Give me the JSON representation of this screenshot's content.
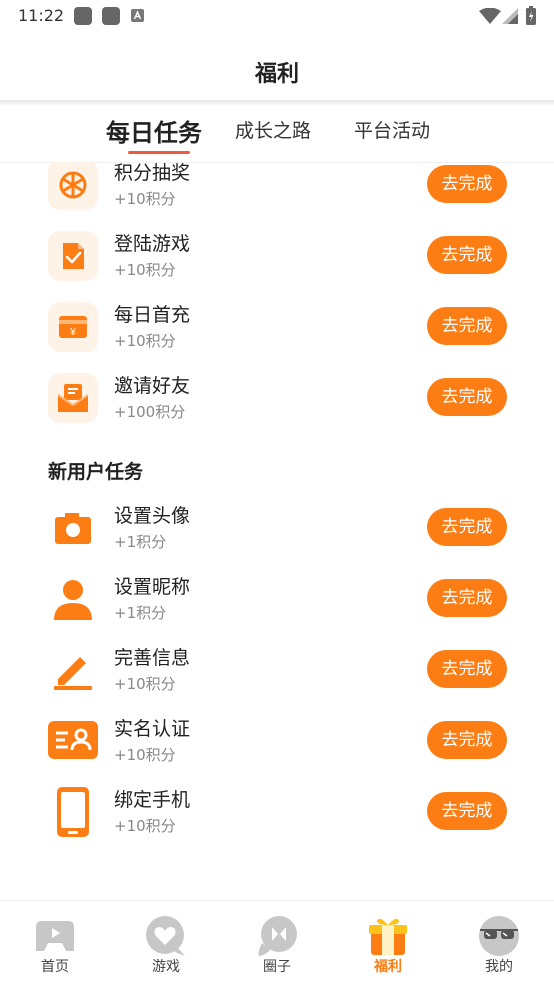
{
  "status_bar": {
    "time": "11:22"
  },
  "header": {
    "title": "福利"
  },
  "tabs": [
    {
      "label": "每日任务",
      "active": true
    },
    {
      "label": "成长之路",
      "active": false
    },
    {
      "label": "平台活动",
      "active": false
    }
  ],
  "daily_tasks": [
    {
      "name": "积分抽奖",
      "points": "+10积分",
      "icon": "lottery-wheel-icon",
      "button": "去完成"
    },
    {
      "name": "登陆游戏",
      "points": "+10积分",
      "icon": "login-check-icon",
      "button": "去完成"
    },
    {
      "name": "每日首充",
      "points": "+10积分",
      "icon": "wallet-yen-icon",
      "button": "去完成"
    },
    {
      "name": "邀请好友",
      "points": "+100积分",
      "icon": "invite-envelope-icon",
      "button": "去完成"
    }
  ],
  "new_user_section": {
    "title": "新用户任务"
  },
  "new_user_tasks": [
    {
      "name": "设置头像",
      "points": "+1积分",
      "icon": "camera-icon",
      "button": "去完成"
    },
    {
      "name": "设置昵称",
      "points": "+1积分",
      "icon": "person-icon",
      "button": "去完成"
    },
    {
      "name": "完善信息",
      "points": "+10积分",
      "icon": "pencil-icon",
      "button": "去完成"
    },
    {
      "name": "实名认证",
      "points": "+10积分",
      "icon": "id-card-icon",
      "button": "去完成"
    },
    {
      "name": "绑定手机",
      "points": "+10积分",
      "icon": "phone-icon",
      "button": "去完成"
    }
  ],
  "bottom_nav": [
    {
      "label": "首页",
      "icon": "gamepad-icon",
      "active": false
    },
    {
      "label": "游戏",
      "icon": "heart-chat-icon",
      "active": false
    },
    {
      "label": "圈子",
      "icon": "circle-chat-icon",
      "active": false
    },
    {
      "label": "福利",
      "icon": "gift-icon",
      "active": true
    },
    {
      "label": "我的",
      "icon": "sunglasses-face-icon",
      "active": false
    }
  ],
  "colors": {
    "accent": "#fb7d14",
    "tab_underline": "#f05a3c",
    "icon_bg": "#fff2e6"
  }
}
